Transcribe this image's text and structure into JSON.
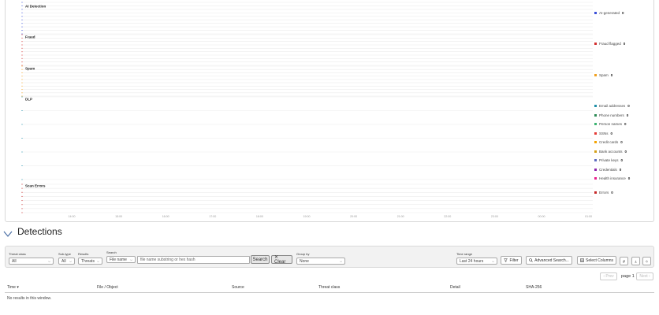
{
  "charts": {
    "panels": [
      {
        "title": "AI Detection"
      },
      {
        "title": "Fraud"
      },
      {
        "title": "Spam"
      },
      {
        "title": "DLP"
      },
      {
        "title": "Scan Errors"
      }
    ],
    "time_ticks": [
      "14:00",
      "15:00",
      "16:00",
      "17:00",
      "18:00",
      "19:00",
      "20:00",
      "21:00",
      "22:00",
      "23:00",
      "00:00",
      "01:00"
    ],
    "legend": [
      {
        "label": "AI-generated",
        "count": "0",
        "color": "#3b4fd8"
      },
      {
        "label": "Fraud flagged",
        "count": "0",
        "color": "#d32f2f"
      },
      {
        "label": "Spam",
        "count": "0",
        "color": "#f0a020"
      },
      {
        "label": "Email addresses",
        "count": "0",
        "color": "#1f8fa8"
      },
      {
        "label": "Phone numbers",
        "count": "0",
        "color": "#2e8b57"
      },
      {
        "label": "Person names",
        "count": "0",
        "color": "#3cb371"
      },
      {
        "label": "SSNs",
        "count": "0",
        "color": "#e53935"
      },
      {
        "label": "Credit cards",
        "count": "0",
        "color": "#f4a300"
      },
      {
        "label": "Bank accounts",
        "count": "0",
        "color": "#d4a017"
      },
      {
        "label": "Private keys",
        "count": "0",
        "color": "#5c6bc0"
      },
      {
        "label": "Credentials",
        "count": "0",
        "color": "#8e24aa"
      },
      {
        "label": "Health insurance",
        "count": "0",
        "color": "#e91e8c"
      },
      {
        "label": "Errors",
        "count": "0",
        "color": "#c62828"
      }
    ]
  },
  "detections": {
    "title": "Detections"
  },
  "filters": {
    "threat_class": {
      "label": "Threat class",
      "value": "All"
    },
    "sub_type": {
      "label": "Sub-type",
      "value": "All"
    },
    "results": {
      "label": "Results",
      "value": "Threats"
    },
    "search": {
      "label": "Search",
      "field": "File name",
      "placeholder": "file name substring or hex hash"
    },
    "search_button": "Search",
    "clear_button": "✕ Clear",
    "group_by": {
      "label": "Group by",
      "value": "None"
    },
    "time_range": {
      "label": "Time range",
      "value": "Last 24 hours"
    },
    "filter_button": "Filter",
    "advanced_search_button": "Advanced Search...",
    "select_columns_button": "Select Columns"
  },
  "pagination": {
    "prev": "‹ Prev",
    "page": "page 1",
    "next": "Next ›"
  },
  "table": {
    "columns": [
      "Time ▾",
      "File / Object",
      "Source",
      "Threat class",
      "Detail",
      "SHA-256"
    ],
    "empty_message": "No results in this window."
  }
}
